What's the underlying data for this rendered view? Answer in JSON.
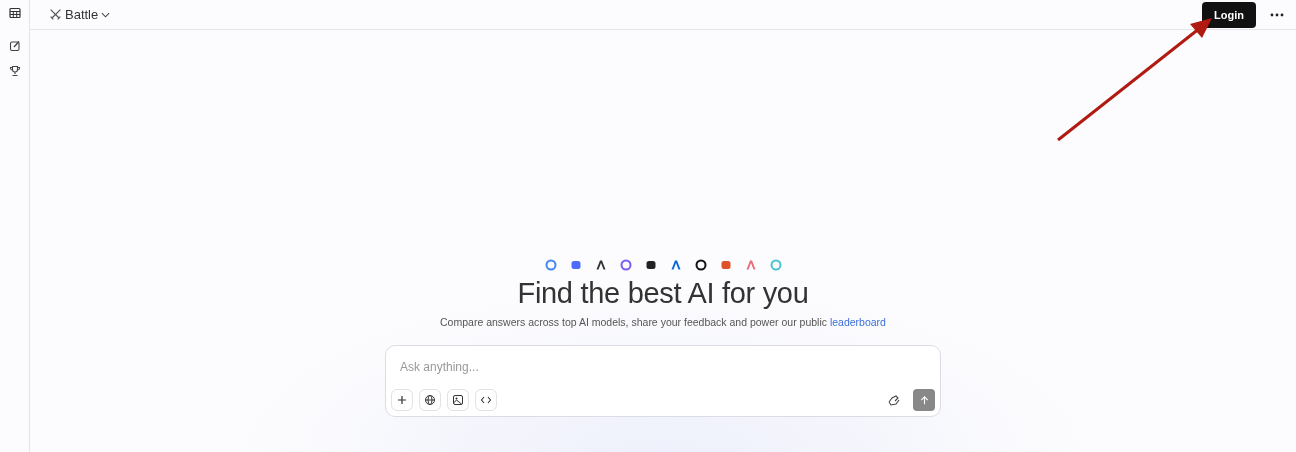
{
  "header": {
    "mode": "Battle",
    "login": "Login"
  },
  "hero": {
    "title": "Find the best AI for you",
    "subtitle": "Compare answers across top AI models, share your feedback and power our public",
    "link": "leaderboard"
  },
  "composer": {
    "placeholder": "Ask anything..."
  }
}
